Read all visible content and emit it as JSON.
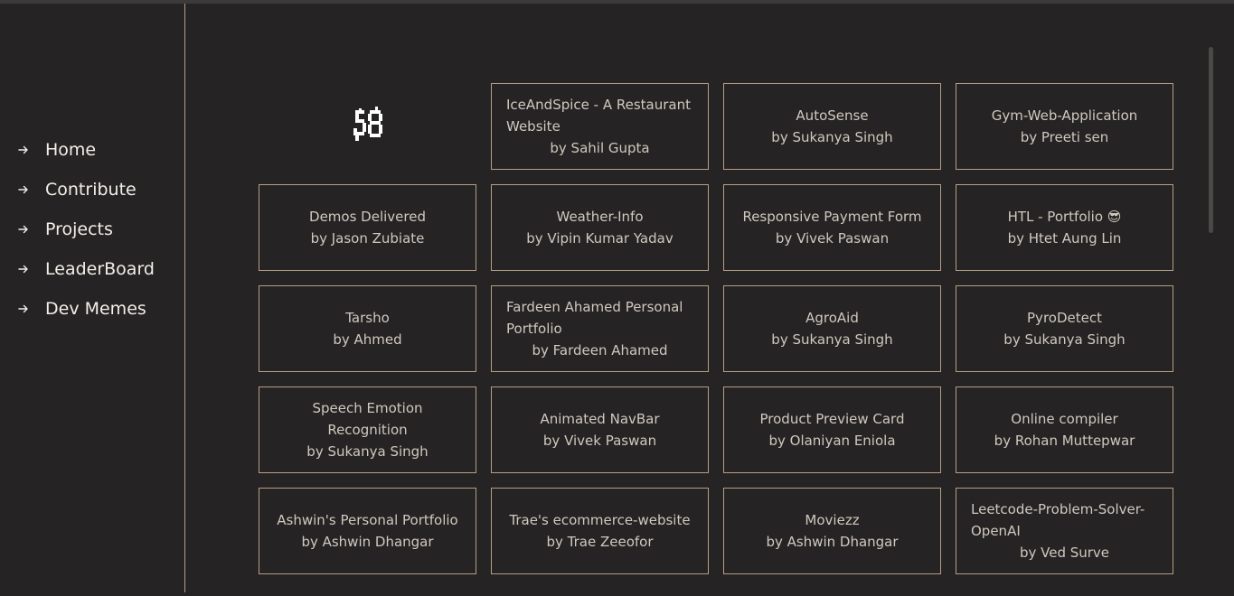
{
  "sidebar": {
    "items": [
      {
        "label": "Home",
        "icon": "arrow-right-icon"
      },
      {
        "label": "Contribute",
        "icon": "arrow-right-icon"
      },
      {
        "label": "Projects",
        "icon": "arrow-right-icon"
      },
      {
        "label": "LeaderBoard",
        "icon": "arrow-right-icon"
      },
      {
        "label": "Dev Memes",
        "icon": "arrow-right-icon"
      }
    ]
  },
  "logo": {
    "text": "58"
  },
  "projects": [
    {
      "title": "IceAndSpice - A Restaurant Website",
      "author": "by Sahil Gupta"
    },
    {
      "title": "AutoSense",
      "author": "by Sukanya Singh"
    },
    {
      "title": "Gym-Web-Application",
      "author": "by Preeti sen"
    },
    {
      "title": "Demos Delivered",
      "author": "by Jason Zubiate"
    },
    {
      "title": "Weather-Info",
      "author": "by Vipin Kumar Yadav"
    },
    {
      "title": "Responsive Payment Form",
      "author": "by Vivek Paswan"
    },
    {
      "title": "HTL - Portfolio 😎",
      "author": "by Htet Aung Lin"
    },
    {
      "title": "Tarsho",
      "author": "by Ahmed"
    },
    {
      "title": "Fardeen Ahamed Personal Portfolio",
      "author": "by Fardeen Ahamed"
    },
    {
      "title": "AgroAid",
      "author": "by Sukanya Singh"
    },
    {
      "title": "PyroDetect",
      "author": "by Sukanya Singh"
    },
    {
      "title": "Speech Emotion Recognition",
      "author": "by Sukanya Singh"
    },
    {
      "title": "Animated NavBar",
      "author": "by Vivek Paswan"
    },
    {
      "title": "Product Preview Card",
      "author": "by Olaniyan Eniola"
    },
    {
      "title": "Online compiler",
      "author": "by Rohan Muttepwar"
    },
    {
      "title": "Ashwin's Personal Portfolio",
      "author": "by Ashwin Dhangar"
    },
    {
      "title": "Trae's ecommerce-website",
      "author": "by Trae Zeeofor"
    },
    {
      "title": "Moviezz",
      "author": "by Ashwin Dhangar"
    },
    {
      "title": "Leetcode-Problem-Solver-OpenAI",
      "author": "by Ved Surve"
    }
  ],
  "colors": {
    "background": "#252323",
    "border": "#b59f84",
    "text": "#cfc9bf",
    "nav_text": "#f2efe9"
  }
}
